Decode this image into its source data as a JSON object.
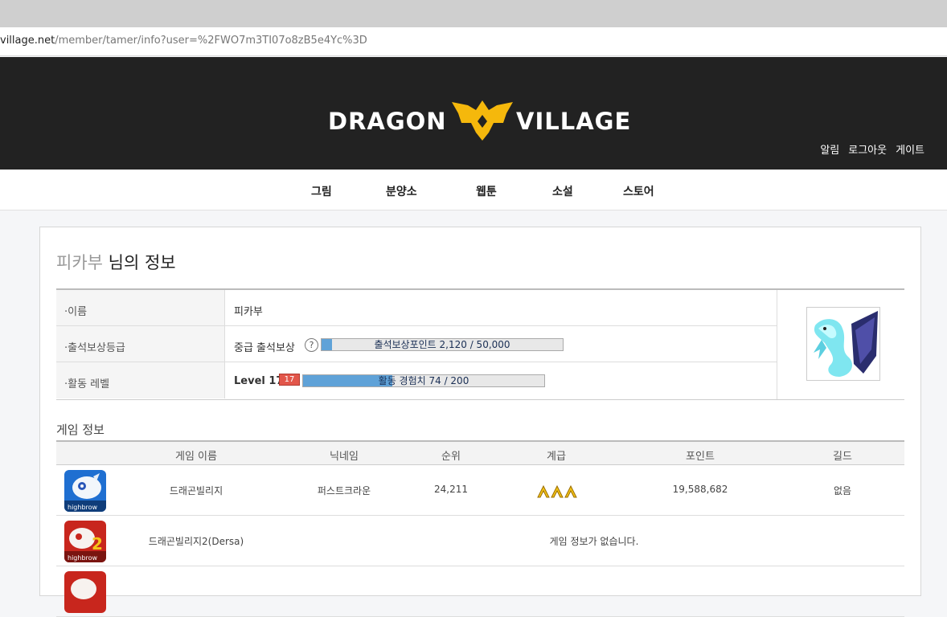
{
  "browser": {
    "url_host": "village.net",
    "url_path": "/member/tamer/info?user=%2FWO7m3TI07o8zB5e4Yc%3D"
  },
  "header": {
    "logo_left": "DRAGON",
    "logo_right": "VILLAGE",
    "links": [
      "알림",
      "로그아웃",
      "게이트"
    ]
  },
  "nav": {
    "items": [
      "그림",
      "분양소",
      "웹툰",
      "소설",
      "스토어"
    ]
  },
  "profile": {
    "title_nick": "피카부",
    "title_suffix": " 님의 정보",
    "rows": {
      "name": {
        "label": "·이름",
        "value": "피카부"
      },
      "attendance": {
        "label": "·출석보상등급",
        "grade": "중급 출석보상",
        "help": "?",
        "bar_text": "출석보상포인트 2,120 / 50,000",
        "progress": 0.0424
      },
      "activity": {
        "label": "·활동 레벨",
        "level_text": "Level 17",
        "badge": "17",
        "bar_text": "활동 경험치 74 / 200",
        "progress": 0.37
      }
    },
    "avatar_icon": "dragon-avatar"
  },
  "games": {
    "section_title": "게임 정보",
    "headers": [
      "게임 이름",
      "닉네임",
      "순위",
      "계급",
      "포인트",
      "길드"
    ],
    "rows": [
      {
        "icon": "dragon-village-1-icon",
        "name": "드래곤빌리지",
        "nickname": "퍼스트크라운",
        "rank": "24,211",
        "grade_icon": "gold-chevrons-icon",
        "points": "19,588,682",
        "guild": "없음"
      },
      {
        "icon": "dragon-village-2-icon",
        "name": "드래곤빌리지2(Dersa)",
        "message": "게임 정보가 없습니다."
      },
      {
        "icon": "dragon-village-3-icon"
      }
    ],
    "icon_brand": "highbrow"
  },
  "colors": {
    "header_bg": "#222222",
    "logo_gold": "#f5b80c",
    "bar_fill": "#5fa2d8",
    "badge_red": "#e2564a"
  }
}
